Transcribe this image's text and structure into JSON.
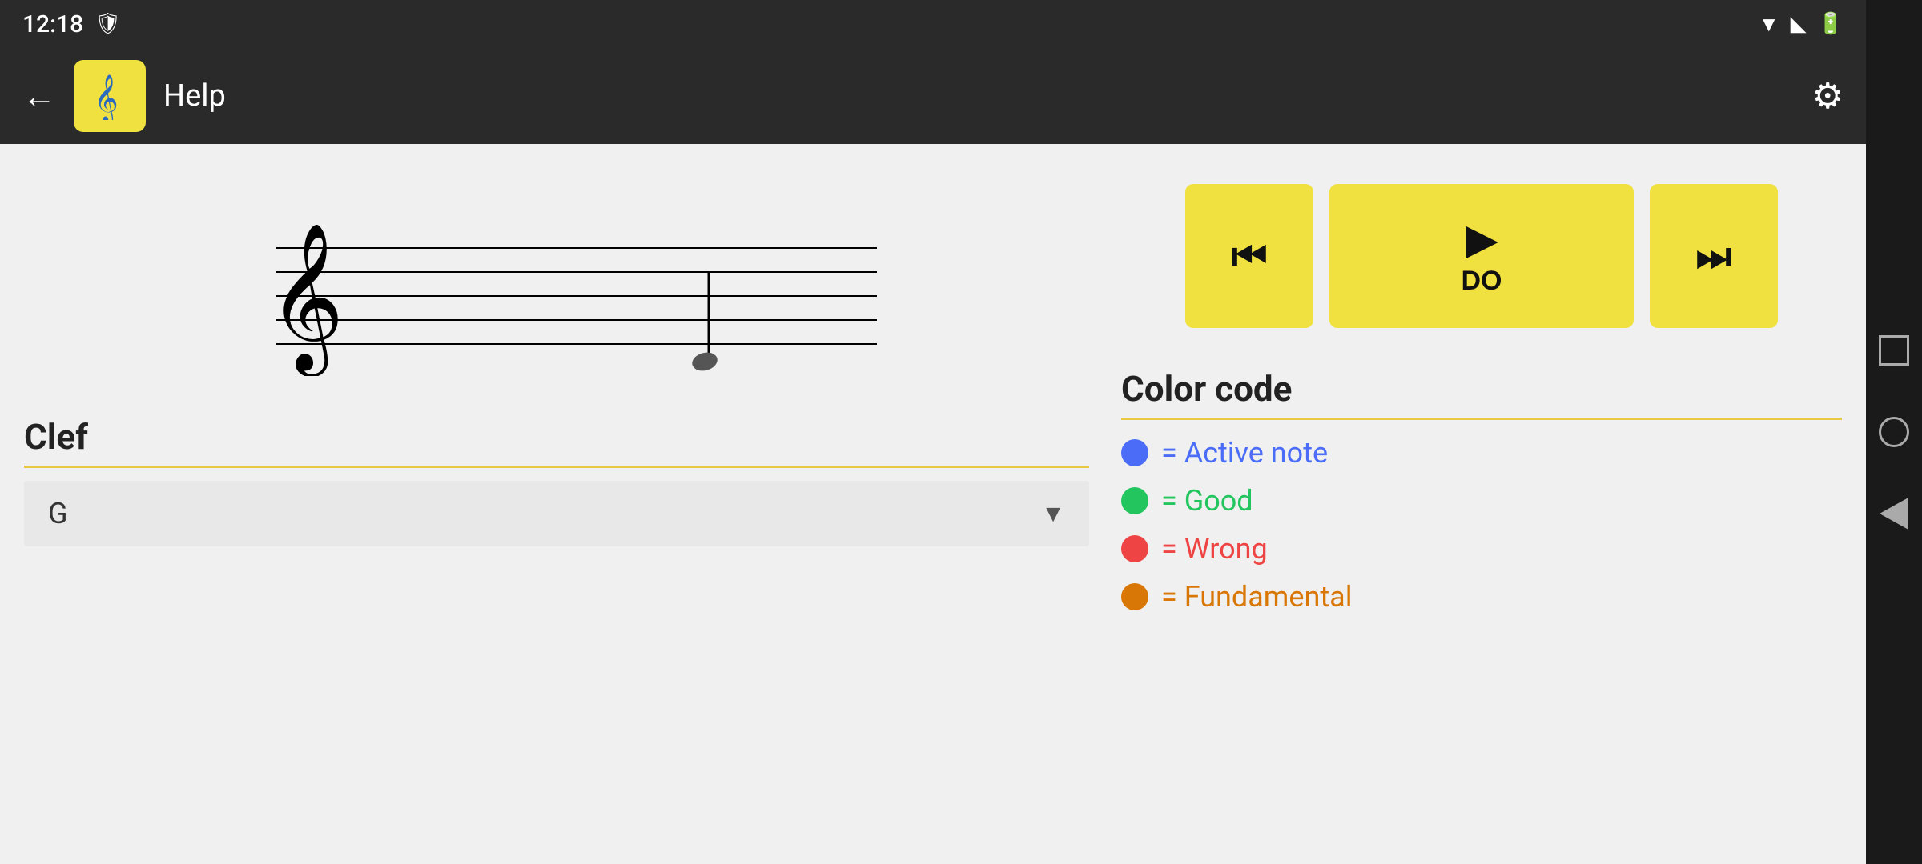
{
  "statusBar": {
    "time": "12:18",
    "shieldIcon": "⊕",
    "wifiIcon": "▼",
    "signalIcon": "◄",
    "batteryIcon": "▐"
  },
  "appBar": {
    "backLabel": "←",
    "appIconEmoji": "𝄞",
    "title": "Help",
    "settingsIcon": "⚙"
  },
  "clef": {
    "sectionTitle": "Clef",
    "selectedValue": "G",
    "dropdownArrow": "▼"
  },
  "playback": {
    "prevLabel": "⏮",
    "playLabel": "▶",
    "playSubLabel": "DO",
    "nextLabel": "⏭"
  },
  "colorCode": {
    "sectionTitle": "Color code",
    "items": [
      {
        "color": "#4a6cf7",
        "text": "= Active note"
      },
      {
        "color": "#22c55e",
        "text": "= Good"
      },
      {
        "color": "#ef4444",
        "text": "= Wrong"
      },
      {
        "color": "#d97706",
        "text": "= Fundamental"
      }
    ]
  },
  "androidNav": {
    "squareTitle": "recent-apps",
    "circleTitle": "home",
    "triangleTitle": "back"
  }
}
